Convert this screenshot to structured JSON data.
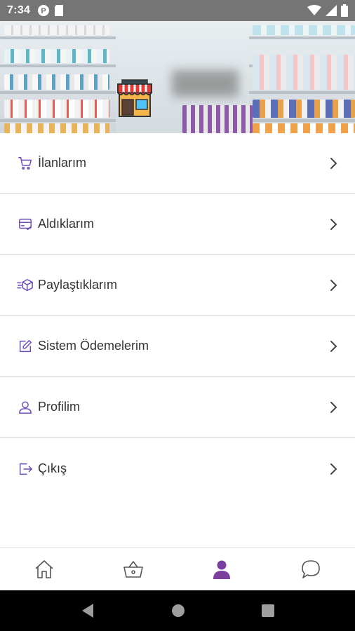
{
  "status_bar": {
    "time": "7:34"
  },
  "menu": {
    "items": [
      {
        "label": "İlanlarım",
        "icon": "cart-icon"
      },
      {
        "label": "Aldıklarım",
        "icon": "purchase-icon"
      },
      {
        "label": "Paylaştıklarım",
        "icon": "shared-box-icon"
      },
      {
        "label": "Sistem Ödemelerim",
        "icon": "edit-icon"
      },
      {
        "label": "Profilim",
        "icon": "user-icon"
      },
      {
        "label": "Çıkış",
        "icon": "logout-icon"
      }
    ]
  },
  "tabbar": {
    "active": "profile",
    "tabs": [
      "home-icon",
      "basket-icon",
      "profile-icon",
      "chat-icon"
    ]
  },
  "colors": {
    "accent": "#7b3fa0",
    "icon_stroke": "#6b4bb8",
    "text": "#333333",
    "inactive_tab": "#555555"
  }
}
